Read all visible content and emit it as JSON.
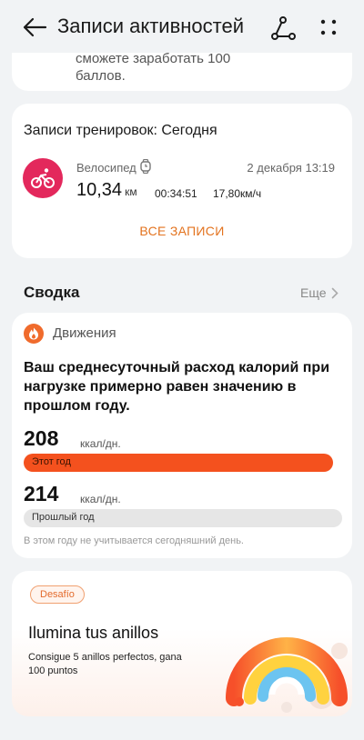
{
  "header": {
    "title": "Записи активностей"
  },
  "top_card": {
    "text_line1": "сможете заработать 100",
    "text_line2": "баллов."
  },
  "workouts": {
    "title": "Записи тренировок: Сегодня",
    "type": "Велосипед",
    "datetime": "2 декабря 13:19",
    "distance": "10,34",
    "distance_unit": "км",
    "duration": "00:34:51",
    "speed": "17,80км/ч",
    "all_records": "ВСЕ ЗАПИСИ",
    "icon": "bike-icon"
  },
  "summary": {
    "title": "Сводка",
    "more": "Еще"
  },
  "movement": {
    "title": "Движения",
    "description": "Ваш среднесуточный расход калорий при нагрузке примерно равен значению в прошлом году.",
    "this_year_value": "208",
    "this_year_unit": "ккал/дн.",
    "this_year_label": "Этот год",
    "last_year_value": "214",
    "last_year_unit": "ккал/дн.",
    "last_year_label": "Прошлый год",
    "note": "В этом году не учитывается сегодняшний день.",
    "colors": {
      "this_year": "#f4511e",
      "last_year": "#e6e6e6"
    }
  },
  "challenge": {
    "badge": "Desafío",
    "title": "Ilumina tus anillos",
    "description": "Consigue 5 anillos perfectos, gana 100 puntos"
  },
  "colors": {
    "accent_orange": "#e3731f",
    "bike_red": "#e3285c"
  }
}
